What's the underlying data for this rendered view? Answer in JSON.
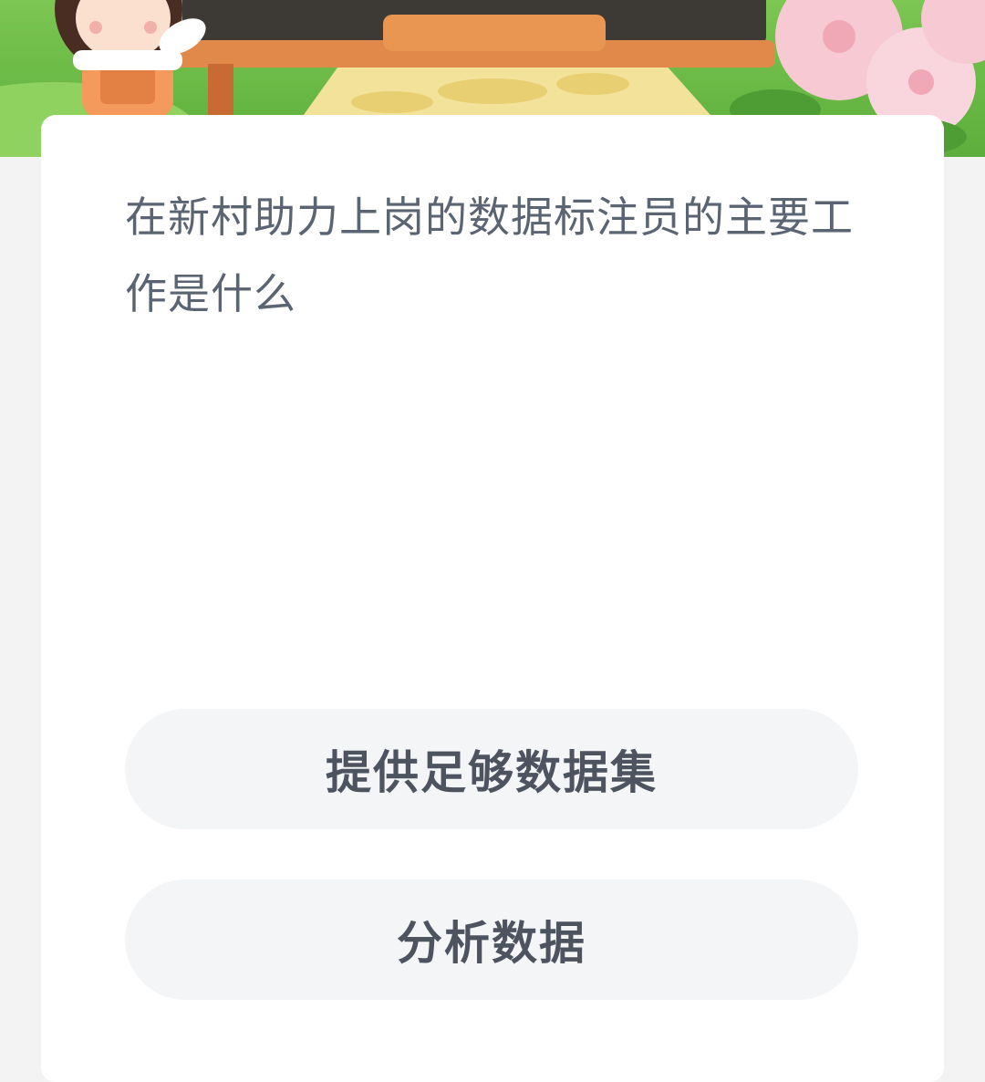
{
  "banner": {
    "icon": "cartoon-farm-banner",
    "colors": {
      "grass": "#6fbf4a",
      "board": "#3d3a36",
      "board_frame": "#e0894a",
      "path": "#f2e29a",
      "flower": "#f7c9d2"
    }
  },
  "quiz": {
    "question": "在新村助力上岗的数据标注员的主要工作是什么",
    "options": [
      {
        "label": "提供足够数据集"
      },
      {
        "label": "分析数据"
      }
    ]
  },
  "colors": {
    "page_bg": "#f3f3f4",
    "card_bg": "#ffffff",
    "question_text": "#5a6472",
    "option_bg": "#f4f5f7",
    "option_text": "#4d5460"
  }
}
